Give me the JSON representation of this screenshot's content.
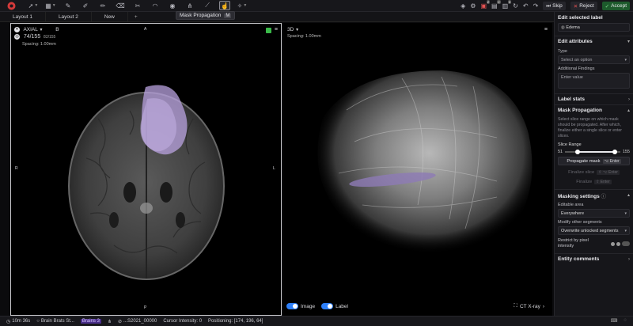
{
  "toolbar": {
    "tooltip_label": "Mask Propagation",
    "tooltip_key": "M",
    "skip_label": "Skip",
    "reject_label": "Reject",
    "accept_label": "Accept",
    "badges": [
      "2",
      "2",
      "3"
    ]
  },
  "tabs": [
    {
      "label": "Layout 1"
    },
    {
      "label": "Layout 2"
    },
    {
      "label": "New"
    },
    {
      "label": "+"
    }
  ],
  "left_viewport": {
    "orientation": "AXIAL",
    "mode": "B",
    "slice": "74/155",
    "slice_extra": "82/155",
    "spacing": "Spacing: 1.00mm",
    "marker_top": "A",
    "marker_bottom": "P",
    "marker_left": "R",
    "marker_right": "L"
  },
  "right_viewport": {
    "mode": "3D",
    "spacing": "Spacing: 1.00mm",
    "toggle_image": "Image",
    "toggle_label": "Label",
    "preset": "CT X-ray"
  },
  "panel": {
    "edit_selected_label": "Edit selected label",
    "selected_label": "Edema",
    "edit_attributes": "Edit attributes",
    "type_label": "Type",
    "type_placeholder": "Select an option",
    "findings_label": "Additional Findings",
    "findings_placeholder": "Enter value",
    "label_stats": "Label stats",
    "mask_propagation": "Mask Propagation",
    "mask_hint": "Select slice range on which mask should be propagated. After which, finalize either a single slice or enter slices.",
    "slice_range_label": "Slice Range",
    "slice_min": "51",
    "slice_max": "155",
    "propagate_label": "Propagate mask",
    "propagate_key": "⌥ Enter",
    "finalize_slice_label": "Finalize slice",
    "finalize_slice_key": "⇧ ⌥ Enter",
    "finalize_label": "Finalize",
    "finalize_key": "⇧ Enter",
    "masking_settings": "Masking settings",
    "editable_area_label": "Editable area",
    "editable_area_value": "Everywhere",
    "modify_label": "Modify other segments",
    "modify_value": "Overwrite unlocked segments",
    "restrict_label": "Restrict by pixel intensity",
    "entity_comments": "Entity comments"
  },
  "statusbar": {
    "time": "10m 36s",
    "dataset": "Brain Brats St...",
    "tag": "Brains 3",
    "file": "...S2021_00000",
    "cursor": "Cursor Intensity: 0",
    "position": "Positioning: [174, 196, 64]"
  },
  "colors": {
    "accent_blue": "#2d7ff9",
    "accept_green": "#1d5a2c",
    "reject_red": "#e35252",
    "mask_purple": "#b9a3e0"
  }
}
